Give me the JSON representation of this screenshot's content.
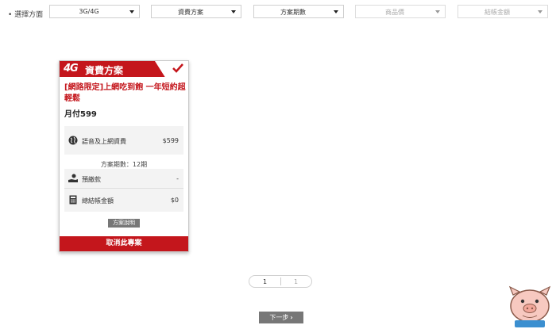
{
  "filter": {
    "label": "• 選擇方面",
    "selects": [
      {
        "value": "3G/4G",
        "disabled": false
      },
      {
        "value": "資費方案",
        "disabled": false
      },
      {
        "value": "方案期數",
        "disabled": false
      },
      {
        "value": "商品價",
        "disabled": true
      },
      {
        "value": "結帳金額",
        "disabled": true
      }
    ]
  },
  "card": {
    "header_logo": "4G",
    "header_title": "資費方案",
    "plan_name": "[網路限定]上網吃到飽 一年短約超輕鬆",
    "monthly_fee": "月付599",
    "voice_data_label": "語音及上網資費",
    "voice_data_value": "$599",
    "contract_term": "方案期數：12期",
    "prepay_label": "預繳款",
    "prepay_value": "-",
    "total_label": "總結帳金額",
    "total_value": "$0",
    "plan_info_button": "方案說明",
    "cancel_button": "取消此專案"
  },
  "pagination": {
    "current": "1",
    "total": "1"
  },
  "next_button": "下一步",
  "colors": {
    "brand_red": "#c4161c",
    "button_gray": "#777777"
  }
}
